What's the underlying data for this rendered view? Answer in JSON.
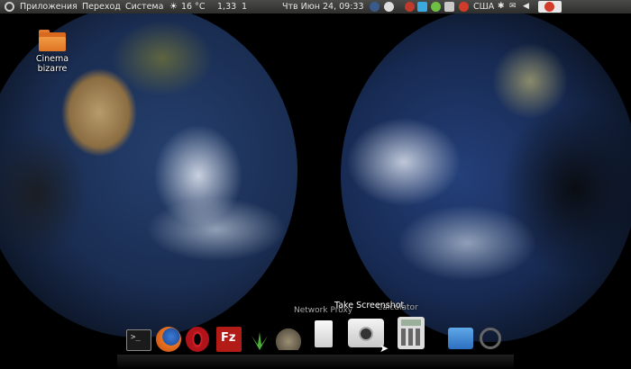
{
  "top_panel": {
    "menus": [
      "Приложения",
      "Переход",
      "Система"
    ],
    "weather": "16 °C",
    "load": "1,33",
    "count": "1",
    "clock": "Чтв Июн 24, 09:33",
    "keyboard_layout": "США"
  },
  "desktop": {
    "icons": [
      {
        "label_line1": "Cinema",
        "label_line2": "bizarre",
        "icon": "folder-icon"
      }
    ]
  },
  "dock": {
    "tooltip_active": "Take Screenshot",
    "tooltip_left": "Network Proxy",
    "tooltip_right": "Calculator",
    "items": [
      "terminal-icon",
      "firefox-icon",
      "opera-icon",
      "filezilla-icon",
      "plant-icon",
      "gimp-icon",
      "network-proxy-icon",
      "camera-icon",
      "calculator-icon",
      "qemu-icon",
      "power-icon"
    ]
  },
  "colors": {
    "panel": "#3c3c3a",
    "folder": "#e07524",
    "accent": "#d13b2a"
  }
}
